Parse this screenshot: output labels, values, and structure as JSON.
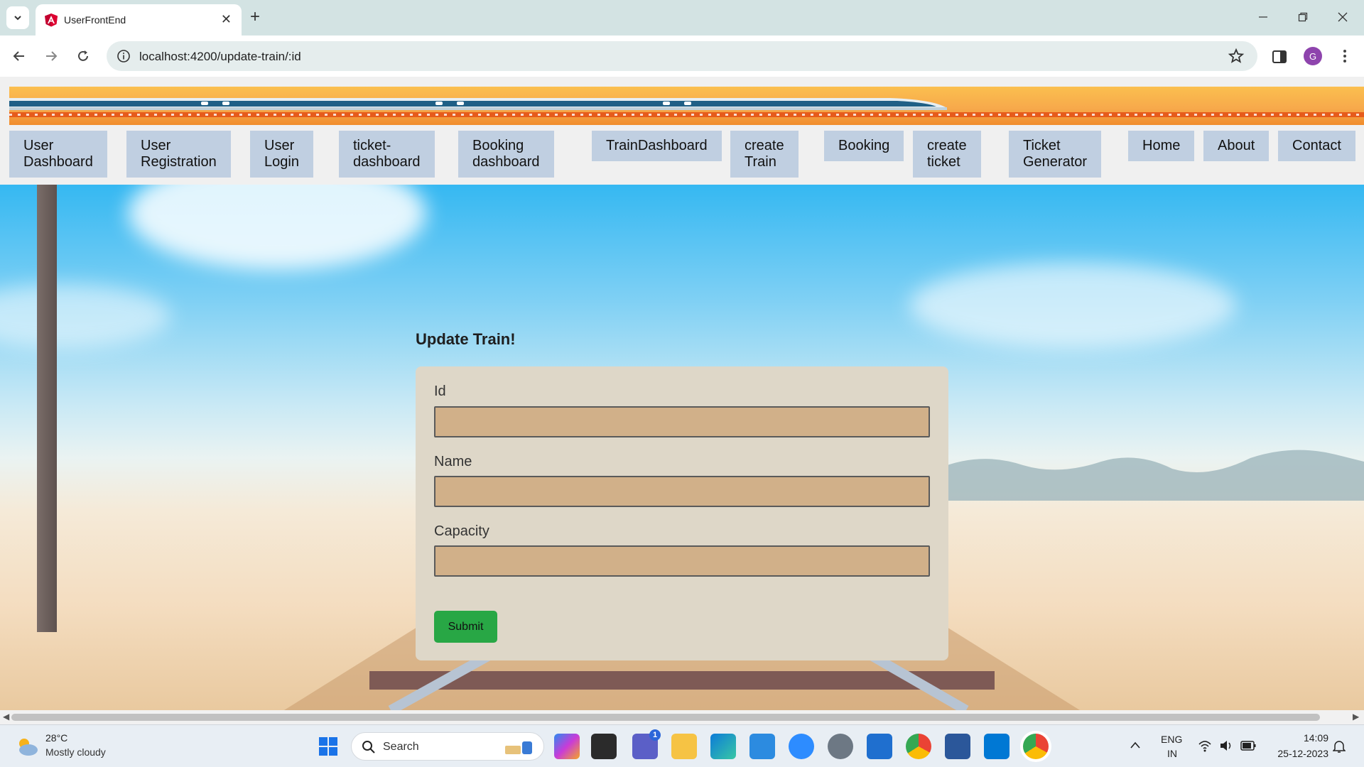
{
  "browser": {
    "tab_title": "UserFrontEnd",
    "close_tab_label": "✕",
    "new_tab_label": "+",
    "url": "localhost:4200/update-train/:id",
    "profile_initial": "G"
  },
  "navbar": {
    "items": [
      "User\nDashboard",
      "User\nRegistration",
      "User\nLogin",
      "ticket-\ndashboard",
      "Booking\ndashboard",
      "TrainDashboard",
      "create\nTrain",
      "Booking",
      "create\nticket",
      "Ticket\nGenerator",
      "Home",
      "About",
      "Contact"
    ]
  },
  "form": {
    "title": "Update Train!",
    "fields": [
      {
        "label": "Id",
        "value": ""
      },
      {
        "label": "Name",
        "value": ""
      },
      {
        "label": "Capacity",
        "value": ""
      }
    ],
    "submit_label": "Submit"
  },
  "taskbar": {
    "weather_temp": "28°C",
    "weather_desc": "Mostly cloudy",
    "search_label": "Search",
    "teams_badge": "1",
    "lang_top": "ENG",
    "lang_bottom": "IN",
    "time": "14:09",
    "date": "25-12-2023"
  },
  "colors": {
    "nav_item_bg": "#c0cfe1",
    "form_card_bg": "#ded7c8",
    "input_bg": "#d1b089",
    "submit_bg": "#28a745"
  }
}
